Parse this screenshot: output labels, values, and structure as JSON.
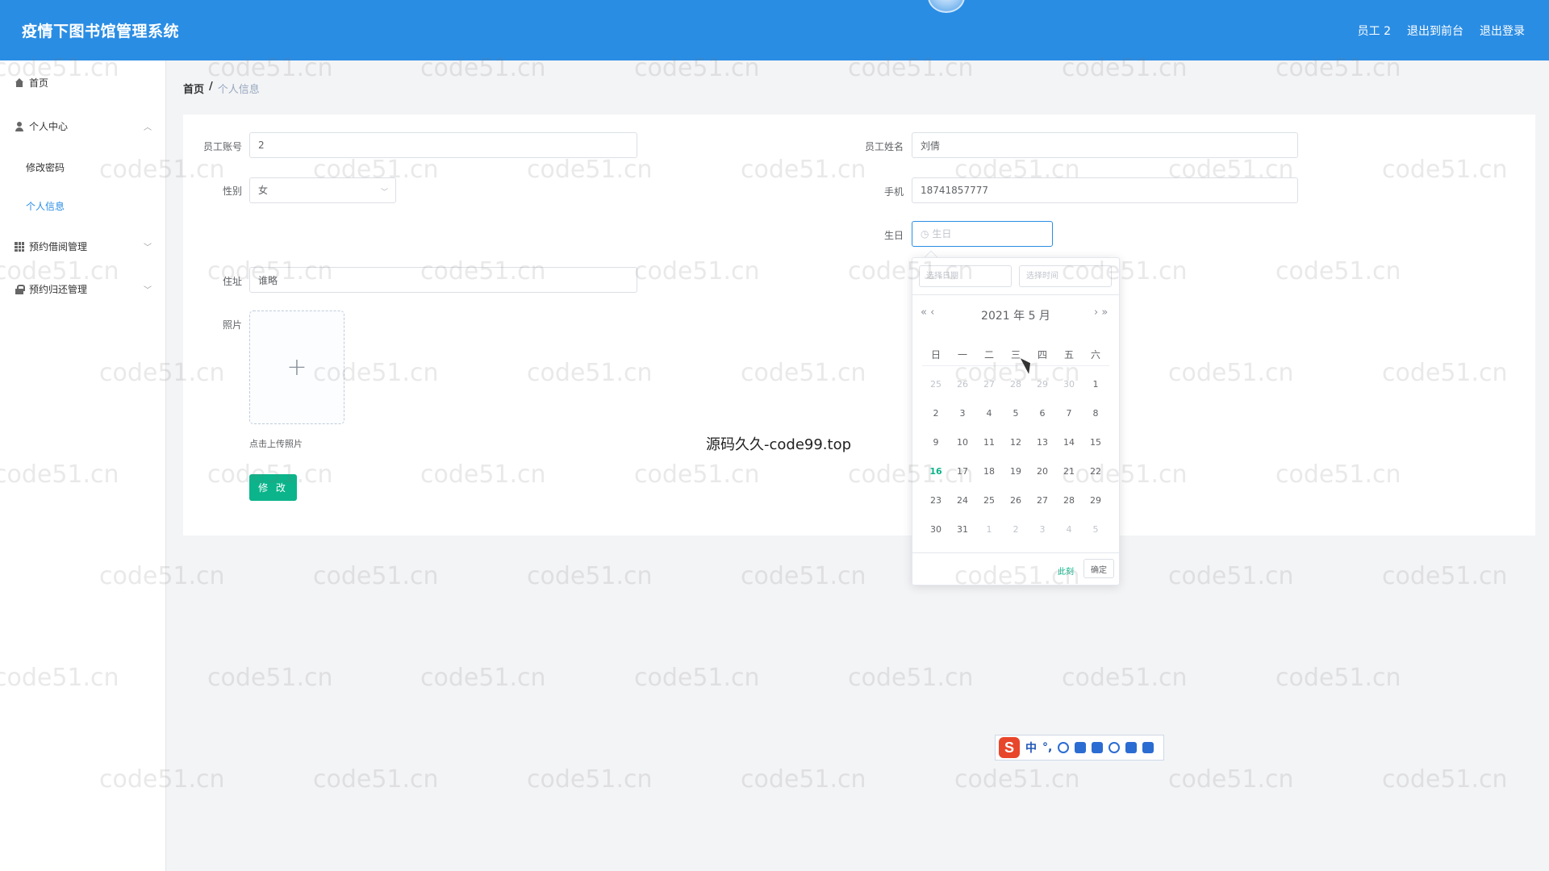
{
  "header": {
    "title": "疫情下图书馆管理系统",
    "user": "员工 2",
    "back_to_front": "退出到前台",
    "logout": "退出登录"
  },
  "sidebar": {
    "home": "首页",
    "personal_center": "个人中心",
    "change_password": "修改密码",
    "personal_info": "个人信息",
    "borrow_mgmt": "预约借阅管理",
    "return_mgmt": "预约归还管理"
  },
  "breadcrumb": {
    "home": "首页",
    "sep": "/",
    "current": "个人信息"
  },
  "form": {
    "account_label": "员工账号",
    "account_value": "2",
    "name_label": "员工姓名",
    "name_value": "刘倩",
    "gender_label": "性别",
    "gender_value": "女",
    "phone_label": "手机",
    "phone_value": "18741857777",
    "birthday_label": "生日",
    "birthday_placeholder": "生日",
    "address_label": "住址",
    "address_value": "谁略",
    "photo_label": "照片",
    "upload_plus": "+",
    "upload_tip": "点击上传照片",
    "submit_label": "修 改"
  },
  "datepicker": {
    "date_placeholder": "选择日期",
    "time_placeholder": "选择时间",
    "prev_nav": "« ‹",
    "next_nav": "› »",
    "title": "2021 年  5 月",
    "weekdays": [
      "日",
      "一",
      "二",
      "三",
      "四",
      "五",
      "六"
    ],
    "weeks": [
      [
        "25",
        "26",
        "27",
        "28",
        "29",
        "30",
        "1"
      ],
      [
        "2",
        "3",
        "4",
        "5",
        "6",
        "7",
        "8"
      ],
      [
        "9",
        "10",
        "11",
        "12",
        "13",
        "14",
        "15"
      ],
      [
        "16",
        "17",
        "18",
        "19",
        "20",
        "21",
        "22"
      ],
      [
        "23",
        "24",
        "25",
        "26",
        "27",
        "28",
        "29"
      ],
      [
        "30",
        "31",
        "1",
        "2",
        "3",
        "4",
        "5"
      ]
    ],
    "today": "16",
    "now_label": "此刻",
    "ok_label": "确定"
  },
  "watermark": {
    "text": "code51.cn",
    "center_text": "源码久久-code99.top"
  },
  "ime": {
    "logo": "S",
    "mode": "中",
    "punct": "°,"
  },
  "colors": {
    "header": "#2a8de4",
    "accent": "#0bb48a",
    "link": "#2a8de4"
  }
}
